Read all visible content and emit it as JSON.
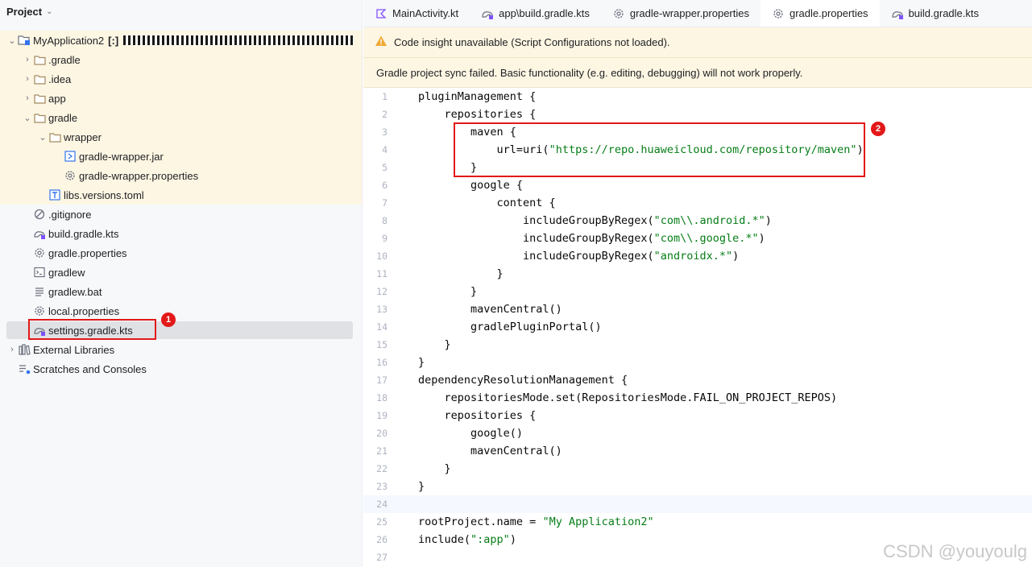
{
  "project_panel": {
    "title": "Project",
    "tree": [
      {
        "label": "MyApplication2",
        "suffix": "[:]",
        "icon": "module-icon",
        "arrow": "⌄",
        "indent": 0
      },
      {
        "label": ".gradle",
        "icon": "folder-icon",
        "arrow": "›",
        "indent": 1
      },
      {
        "label": ".idea",
        "icon": "folder-icon",
        "arrow": "›",
        "indent": 1
      },
      {
        "label": "app",
        "icon": "folder-icon",
        "arrow": "›",
        "indent": 1
      },
      {
        "label": "gradle",
        "icon": "folder-icon",
        "arrow": "⌄",
        "indent": 1
      },
      {
        "label": "wrapper",
        "icon": "folder-icon",
        "arrow": "⌄",
        "indent": 2
      },
      {
        "label": "gradle-wrapper.jar",
        "icon": "jar-icon",
        "indent": 3
      },
      {
        "label": "gradle-wrapper.properties",
        "icon": "gear-icon",
        "indent": 3
      },
      {
        "label": "libs.versions.toml",
        "icon": "toml-icon",
        "indent": 2
      },
      {
        "label": ".gitignore",
        "icon": "ignore-icon",
        "indent": 1
      },
      {
        "label": "build.gradle.kts",
        "icon": "gradle-icon",
        "indent": 1
      },
      {
        "label": "gradle.properties",
        "icon": "gear-icon",
        "indent": 1
      },
      {
        "label": "gradlew",
        "icon": "terminal-icon",
        "indent": 1
      },
      {
        "label": "gradlew.bat",
        "icon": "text-icon",
        "indent": 1
      },
      {
        "label": "local.properties",
        "icon": "gear-icon",
        "indent": 1
      },
      {
        "label": "settings.gradle.kts",
        "icon": "gradle-icon",
        "indent": 1
      },
      {
        "label": "External Libraries",
        "icon": "library-icon",
        "arrow": "›",
        "indent": 0
      },
      {
        "label": "Scratches and Consoles",
        "icon": "scratches-icon",
        "indent": 0
      }
    ]
  },
  "tabs": [
    {
      "label": "MainActivity.kt",
      "icon": "kotlin-icon"
    },
    {
      "label": "app\\build.gradle.kts",
      "icon": "gradle-icon"
    },
    {
      "label": "gradle-wrapper.properties",
      "icon": "gear-icon"
    },
    {
      "label": "gradle.properties",
      "icon": "gear-icon",
      "active": true
    },
    {
      "label": "build.gradle.kts",
      "icon": "gradle-icon"
    }
  ],
  "banners": {
    "warning": "Code insight unavailable (Script Configurations not loaded).",
    "sync_failed": "Gradle project sync failed. Basic functionality (e.g. editing, debugging) will not work properly."
  },
  "annotations": {
    "marker1": "1",
    "marker2": "2"
  },
  "editor": {
    "current_line": 24,
    "lines": [
      [
        {
          "t": "pluginManagement {"
        }
      ],
      [
        {
          "t": "    repositories {"
        }
      ],
      [
        {
          "t": "        maven {"
        }
      ],
      [
        {
          "t": "            url=uri("
        },
        {
          "t": "\"https://repo.huaweicloud.com/repository/maven\"",
          "s": 1
        },
        {
          "t": ")"
        }
      ],
      [
        {
          "t": "        }"
        }
      ],
      [
        {
          "t": "        google {"
        }
      ],
      [
        {
          "t": "            content {"
        }
      ],
      [
        {
          "t": "                includeGroupByRegex("
        },
        {
          "t": "\"com\\\\.android.*\"",
          "s": 1
        },
        {
          "t": ")"
        }
      ],
      [
        {
          "t": "                includeGroupByRegex("
        },
        {
          "t": "\"com\\\\.google.*\"",
          "s": 1
        },
        {
          "t": ")"
        }
      ],
      [
        {
          "t": "                includeGroupByRegex("
        },
        {
          "t": "\"androidx.*\"",
          "s": 1
        },
        {
          "t": ")"
        }
      ],
      [
        {
          "t": "            }"
        }
      ],
      [
        {
          "t": "        }"
        }
      ],
      [
        {
          "t": "        mavenCentral()"
        }
      ],
      [
        {
          "t": "        gradlePluginPortal()"
        }
      ],
      [
        {
          "t": "    }"
        }
      ],
      [
        {
          "t": "}"
        }
      ],
      [
        {
          "t": "dependencyResolutionManagement {"
        }
      ],
      [
        {
          "t": "    repositoriesMode.set(RepositoriesMode.FAIL_ON_PROJECT_REPOS)"
        }
      ],
      [
        {
          "t": "    repositories {"
        }
      ],
      [
        {
          "t": "        google()"
        }
      ],
      [
        {
          "t": "        mavenCentral()"
        }
      ],
      [
        {
          "t": "    }"
        }
      ],
      [
        {
          "t": "}"
        }
      ],
      [
        {
          "t": ""
        }
      ],
      [
        {
          "t": "rootProject.name = "
        },
        {
          "t": "\"My Application2\"",
          "s": 1
        }
      ],
      [
        {
          "t": "include("
        },
        {
          "t": "\":app\"",
          "s": 1
        },
        {
          "t": ")"
        }
      ],
      [
        {
          "t": ""
        }
      ]
    ]
  },
  "watermark": "CSDN @youyoulg",
  "colors": {
    "annotation": "#e31818",
    "banner": "#fdf6e3",
    "string": "#067d17",
    "selection": "#dfe1e5"
  }
}
